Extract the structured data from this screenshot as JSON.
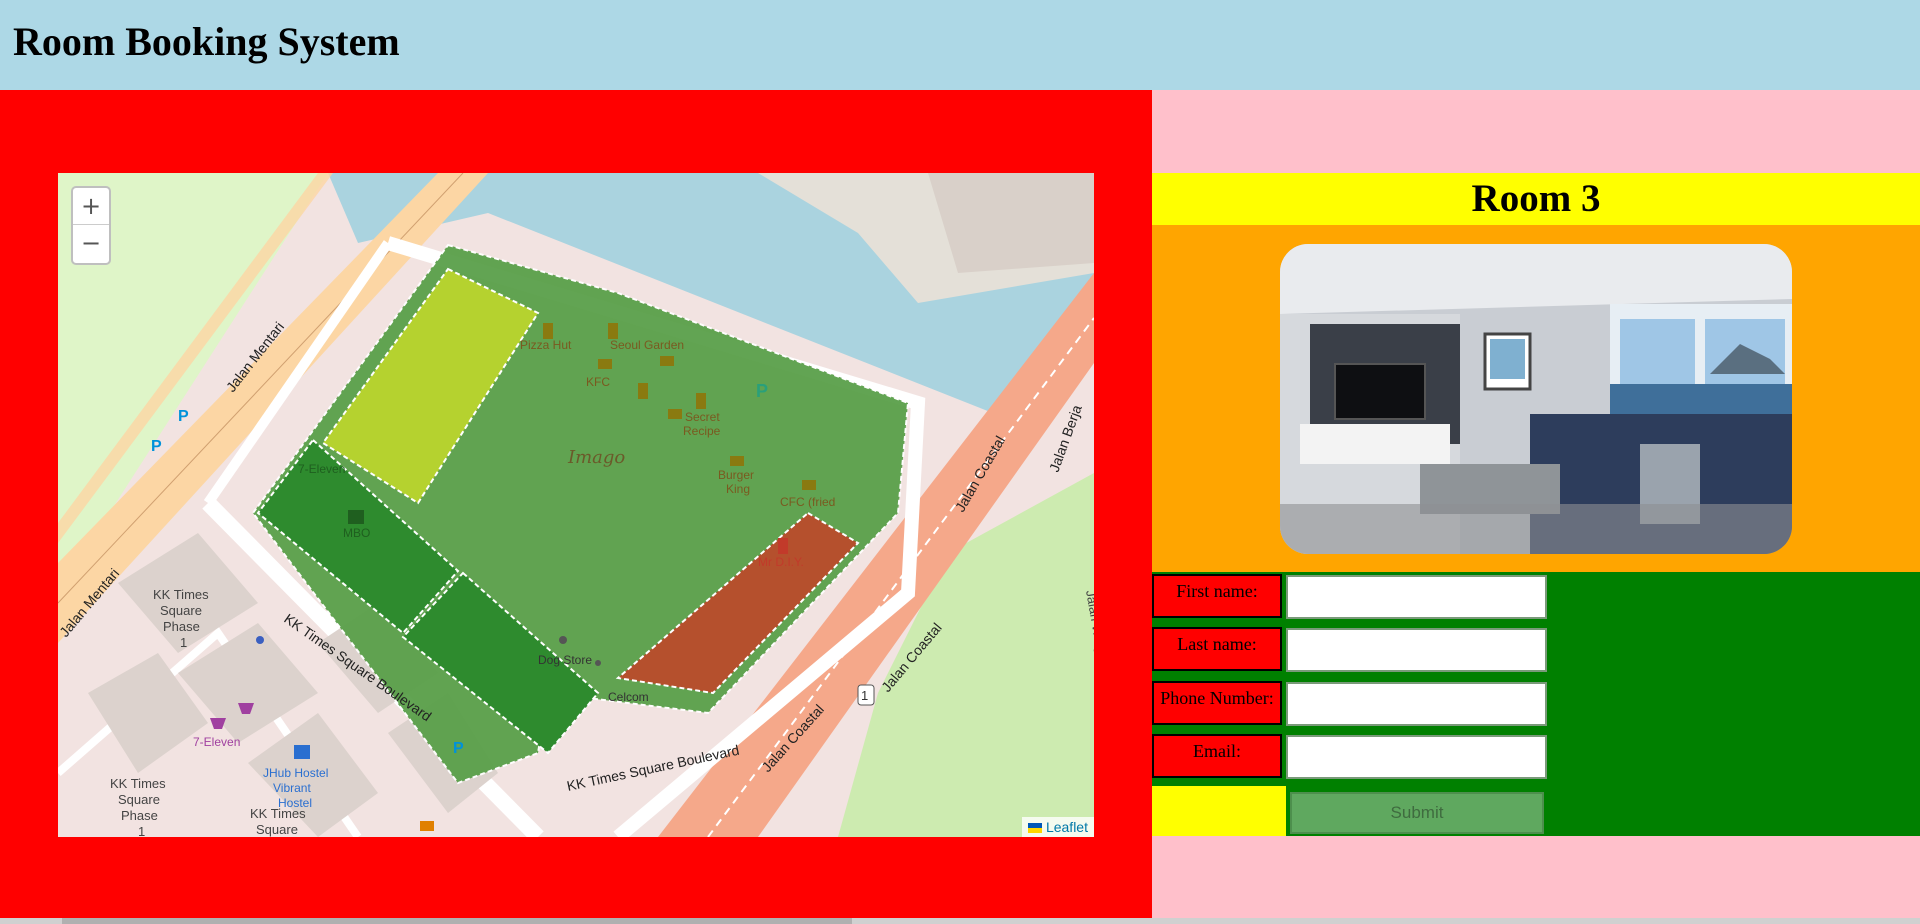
{
  "header": {
    "title": "Room Booking System"
  },
  "map": {
    "zoom_in": "+",
    "zoom_out": "−",
    "attribution": "Leaflet",
    "labels": {
      "jalan_mentari_1": "Jalan Mentari",
      "jalan_mentari_2": "Jalan Mentari",
      "jalan_coastal_1": "Jalan Coastal",
      "jalan_coastal_2": "Jalan Coastal",
      "jalan_coastal_3": "Jalan Coastal",
      "jalan_berjaya": "Jalan Berja",
      "jalan_wing": "Jalan Wing",
      "kk_boulevard_1": "KK Times Square Boulevard",
      "kk_boulevard_2": "KK Times Square Boulevard",
      "imago": "Imago",
      "pizza_hut": "Pizza Hut",
      "seoul_garden": "Seoul Garden",
      "kfc": "KFC",
      "secret_recipe_1": "Secret",
      "secret_recipe_2": "Recipe",
      "burger_king_1": "Burger",
      "burger_king_2": "King",
      "cfc": "CFC (fried",
      "mr_diy": "Mr D.I.Y.",
      "mbo": "MBO",
      "seven_eleven_1": "7-Eleven",
      "seven_eleven_2": "7-Eleven",
      "dog_store": "Dog Store",
      "celcom": "Celcom",
      "phase1_a_1": "KK Times",
      "phase1_a_2": "Square",
      "phase1_a_3": "Phase",
      "phase1_a_4": "1",
      "phase1_b_1": "KK Times",
      "phase1_b_2": "Square",
      "phase1_b_3": "Phase",
      "phase1_b_4": "1",
      "kk_times_c_1": "KK Times",
      "kk_times_c_2": "Square",
      "jhub_1": "JHub Hostel",
      "jhub_2": "Vibrant",
      "jhub_3": "Hostel",
      "route_1": "1",
      "parking": "P"
    },
    "polygon_colors": {
      "imago_area": "#5aa04a",
      "yellow_green": "#b5d22f",
      "dark_green": "#2e8b2e",
      "orange_red": "#b5502d"
    }
  },
  "room": {
    "title": "Room 3"
  },
  "form": {
    "first_name_label": "First name:",
    "last_name_label": "Last name:",
    "phone_label": "Phone Number:",
    "email_label": "Email:",
    "first_name_value": "",
    "last_name_value": "",
    "phone_value": "",
    "email_value": "",
    "submit_label": "Submit"
  },
  "colors": {
    "header_bg": "#add8e6",
    "left_panel_bg": "#ff0000",
    "right_panel_bg": "#ffc0cb",
    "title_bar_bg": "#ffff00",
    "photo_area_bg": "#ffa500",
    "form_bg": "#008000",
    "label_bg": "#ff0000",
    "submit_bg": "#5fa85f"
  }
}
